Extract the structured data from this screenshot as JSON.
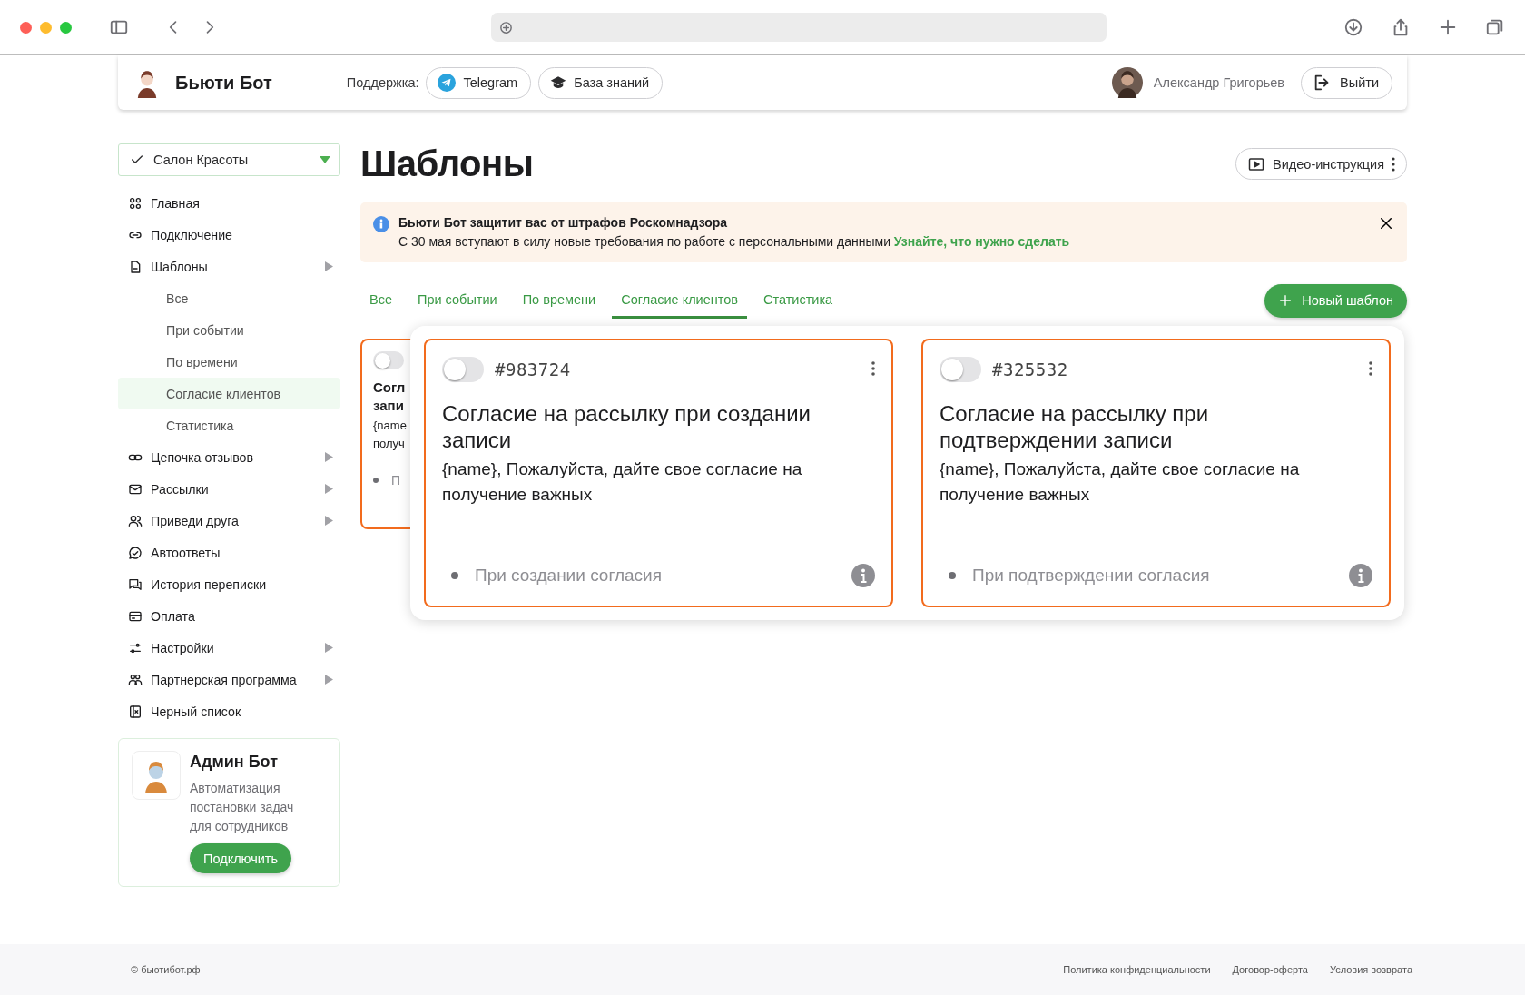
{
  "header": {
    "brand": "Бьюти Бот",
    "support_label": "Поддержка:",
    "support_buttons": [
      {
        "kind": "telegram",
        "label": "Telegram"
      },
      {
        "kind": "knowledge",
        "label": "База знаний"
      }
    ],
    "user_name": "Александр Григорьев",
    "logout": "Выйти"
  },
  "sidebar": {
    "salon_select": {
      "value": "Салон Красоты"
    },
    "items": [
      {
        "kind": "grid",
        "label": "Главная",
        "has_submenu": false,
        "selected": false
      },
      {
        "kind": "link",
        "label": "Подключение",
        "has_submenu": false,
        "selected": false
      },
      {
        "kind": "doc",
        "label": "Шаблоны",
        "has_submenu": true,
        "selected": false,
        "children": [
          {
            "label": "Все",
            "selected": false
          },
          {
            "label": "При событии",
            "selected": false
          },
          {
            "label": "По времени",
            "selected": false
          },
          {
            "label": "Согласие клиентов",
            "selected": true
          },
          {
            "label": "Статистика",
            "selected": false
          }
        ]
      },
      {
        "kind": "chain",
        "label": "Цепочка отзывов",
        "has_submenu": true,
        "selected": false
      },
      {
        "kind": "mail",
        "label": "Рассылки",
        "has_submenu": true,
        "selected": false
      },
      {
        "kind": "users",
        "label": "Приведи друга",
        "has_submenu": true,
        "selected": false
      },
      {
        "kind": "chat",
        "label": "Автоответы",
        "has_submenu": false,
        "selected": false
      },
      {
        "kind": "messages",
        "label": "История переписки",
        "has_submenu": false,
        "selected": false
      },
      {
        "kind": "card",
        "label": "Оплата",
        "has_submenu": false,
        "selected": false
      },
      {
        "kind": "sliders",
        "label": "Настройки",
        "has_submenu": true,
        "selected": false
      },
      {
        "kind": "partners",
        "label": "Партнерская программа",
        "has_submenu": true,
        "selected": false
      },
      {
        "kind": "block",
        "label": "Черный список",
        "has_submenu": false,
        "selected": false
      }
    ],
    "promo": {
      "title": "Админ Бот",
      "text": "Автоматизация постановки задач для сотрудников",
      "button": "Подключить"
    }
  },
  "main": {
    "title": "Шаблоны",
    "video_button": "Видео-инструкция",
    "notice": {
      "title": "Бьюти Бот защитит вас от штрафов Роскомнадзора",
      "text": "С 30 мая вступают в силу новые требования по работе с персональными данными",
      "link": "Узнайте, что нужно сделать"
    },
    "tabs": [
      {
        "label": "Все",
        "selected": false
      },
      {
        "label": "При событии",
        "selected": false
      },
      {
        "label": "По времени",
        "selected": false
      },
      {
        "label": "Согласие клиентов",
        "selected": true
      },
      {
        "label": "Статистика",
        "selected": false
      }
    ],
    "new_button": "Новый шаблон",
    "partial_card": {
      "on": false,
      "title_lines": [
        "Согл",
        "запи"
      ],
      "text_lines": [
        "{name",
        "получ"
      ],
      "trigger": "П"
    },
    "cards": [
      {
        "id": "#983724",
        "on": false,
        "title": "Согласие на рассылку при создании записи",
        "text": "{name}, Пожалуйста, дайте свое согласие на получение важных",
        "trigger": "При создании согласия"
      },
      {
        "id": "#325532",
        "on": false,
        "title": "Согласие на рассылку при подтверждении записи",
        "text": "{name}, Пожалуйста, дайте свое согласие на получение важных",
        "trigger": "При подтверждении согласия"
      }
    ]
  },
  "footer": {
    "copyright": "© бьютибот.рф",
    "links": [
      "Политика конфиденциальности",
      "Договор-оферта",
      "Условия возврата"
    ]
  }
}
